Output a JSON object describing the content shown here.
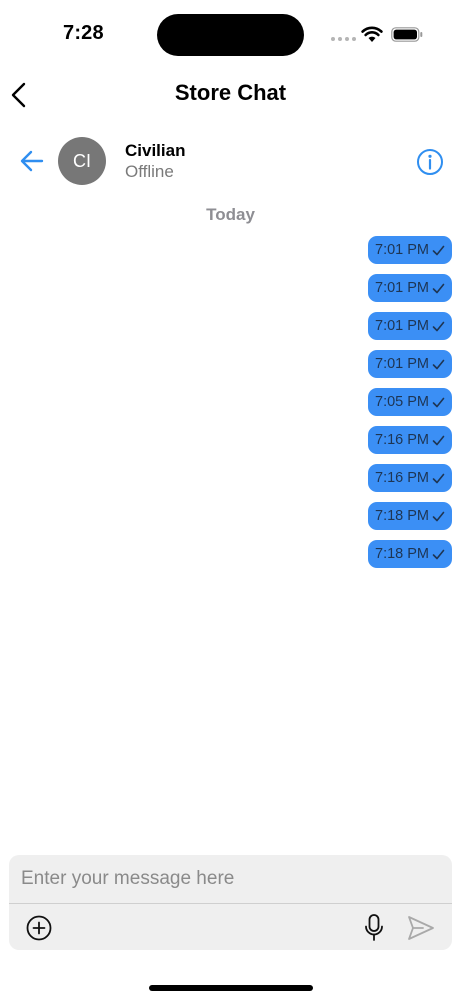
{
  "status_bar": {
    "time": "7:28",
    "icons": [
      "signal-dots-icon",
      "wifi-icon",
      "battery-icon"
    ]
  },
  "nav": {
    "title": "Store Chat",
    "back_icon": "chevron-left-icon"
  },
  "contact": {
    "avatar_initials": "CI",
    "name": "Civilian",
    "status": "Offline",
    "back_icon": "arrow-left-icon",
    "info_icon": "info-icon"
  },
  "chat": {
    "date_label": "Today",
    "messages": [
      {
        "time": "7:01 PM",
        "read": true
      },
      {
        "time": "7:01 PM",
        "read": true
      },
      {
        "time": "7:01 PM",
        "read": true
      },
      {
        "time": "7:01 PM",
        "read": true
      },
      {
        "time": "7:05 PM",
        "read": true
      },
      {
        "time": "7:16 PM",
        "read": true
      },
      {
        "time": "7:16 PM",
        "read": true
      },
      {
        "time": "7:18 PM",
        "read": true
      },
      {
        "time": "7:18 PM",
        "read": true
      }
    ]
  },
  "composer": {
    "value": "",
    "placeholder": "Enter your message here",
    "attach_icon": "plus-circle-icon",
    "mic_icon": "microphone-icon",
    "send_icon": "send-icon"
  },
  "colors": {
    "accent": "#2f8ef0",
    "bubble": "#3b8ff5",
    "bubble_text": "#1e3553",
    "avatar_bg": "#777777",
    "secondary_text": "#8e8e93",
    "composer_bg": "#efefef"
  }
}
